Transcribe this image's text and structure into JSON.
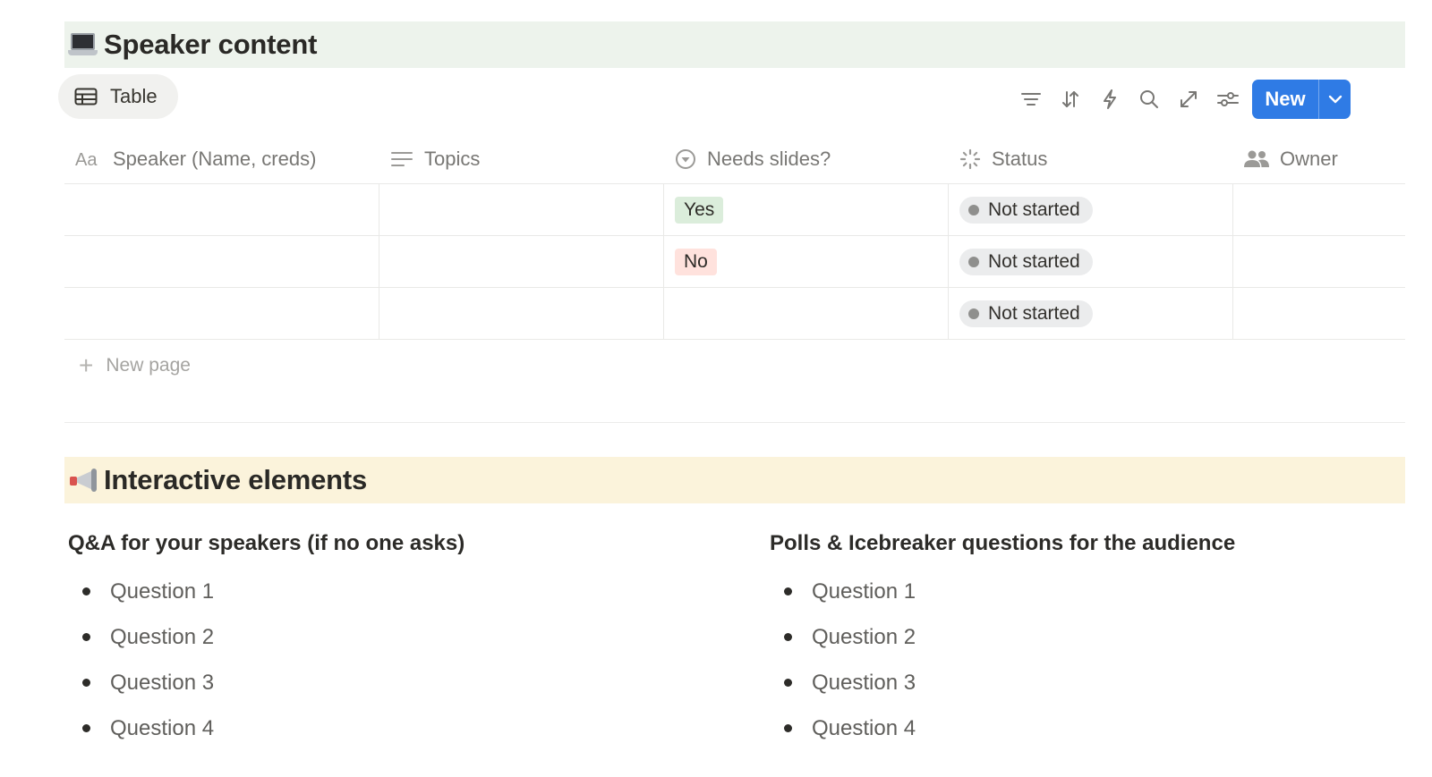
{
  "sections": {
    "speaker_content": {
      "title": "Speaker content",
      "emoji": "laptop-icon"
    },
    "interactive": {
      "title": "Interactive elements",
      "emoji": "megaphone-icon"
    }
  },
  "view": {
    "tab_label": "Table"
  },
  "toolbar": {
    "icons": [
      "filter-icon",
      "sort-icon",
      "automation-icon",
      "search-icon",
      "expand-icon",
      "settings-icon"
    ],
    "new_label": "New"
  },
  "table": {
    "columns": [
      {
        "label": "Speaker (Name, creds)",
        "icon": "text-type-icon"
      },
      {
        "label": "Topics",
        "icon": "lines-icon"
      },
      {
        "label": "Needs slides?",
        "icon": "select-icon"
      },
      {
        "label": "Status",
        "icon": "status-icon"
      },
      {
        "label": "Owner",
        "icon": "people-icon"
      }
    ],
    "rows": [
      {
        "speaker": "",
        "topics": "",
        "needs_slides": "Yes",
        "status": "Not started",
        "owner": ""
      },
      {
        "speaker": "",
        "topics": "",
        "needs_slides": "No",
        "status": "Not started",
        "owner": ""
      },
      {
        "speaker": "",
        "topics": "",
        "needs_slides": "",
        "status": "Not started",
        "owner": ""
      }
    ],
    "new_page_label": "New page"
  },
  "interactive": {
    "left": {
      "title": "Q&A for your speakers (if no one asks)",
      "items": [
        "Question 1",
        "Question 2",
        "Question 3",
        "Question 4"
      ]
    },
    "right": {
      "title": "Polls & Icebreaker questions for the audience",
      "items": [
        "Question 1",
        "Question 2",
        "Question 3",
        "Question 4"
      ]
    }
  },
  "colors": {
    "accent": "#2f7be5",
    "heading1_bg": "#edf3ec",
    "heading2_bg": "#fbf3db",
    "yes_tag": "#dbeddb",
    "no_tag": "#ffe2dd",
    "status_bg": "#ebeced"
  }
}
